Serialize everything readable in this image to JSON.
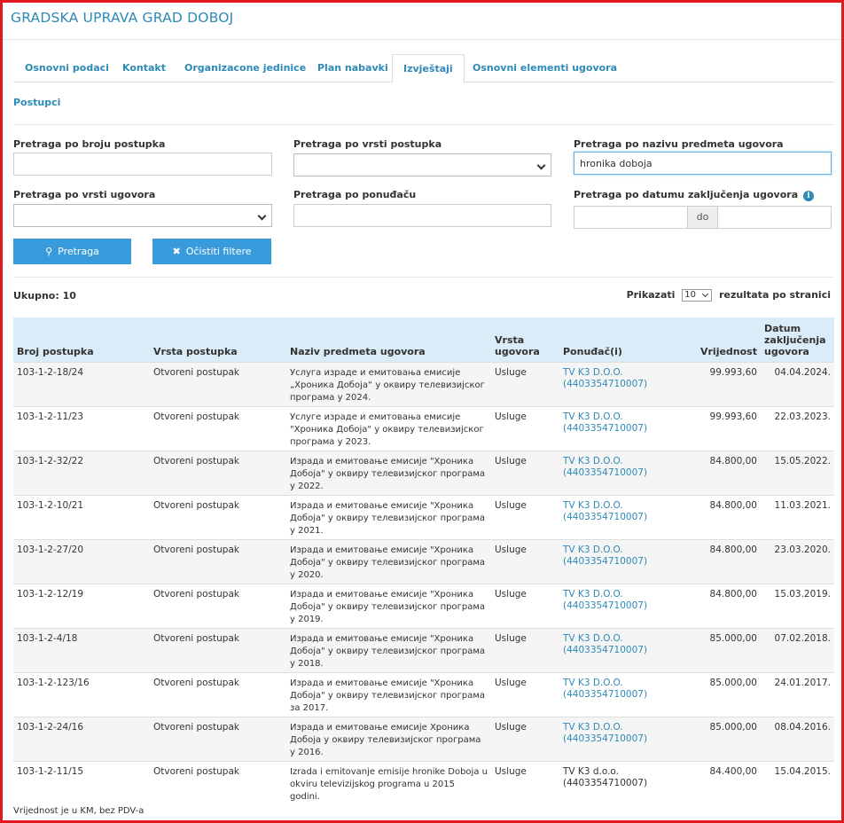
{
  "header": {
    "title": "GRADSKA UPRAVA GRAD DOBOJ"
  },
  "tabs": [
    {
      "label": "Osnovni podaci"
    },
    {
      "label": "Kontakt"
    },
    {
      "label": "Organizacone jedinice"
    },
    {
      "label": "Plan nabavki"
    },
    {
      "label": "Izvještaji",
      "active": true
    },
    {
      "label": "Osnovni elementi ugovora"
    }
  ],
  "subnav": {
    "label": "Postupci"
  },
  "filters": {
    "broj_label": "Pretraga po broju postupka",
    "broj_value": "",
    "vrsta_postupka_label": "Pretraga po vrsti postupka",
    "naziv_label": "Pretraga po nazivu predmeta ugovora",
    "naziv_value": "hronika doboja",
    "vrsta_ugovora_label": "Pretraga po vrsti ugovora",
    "ponudjac_label": "Pretraga po ponuđaču",
    "ponudjac_value": "",
    "datum_label": "Pretraga po datumu zaključenja ugovora",
    "datum_info_icon": "info-icon",
    "date_sep": "do",
    "search_button": "Pretraga",
    "search_icon": "search-icon",
    "clear_button": "Očistiti filtere",
    "clear_icon": "close-icon"
  },
  "results": {
    "total_label": "Ukupno: 10",
    "show_label": "Prikazati",
    "per_page": "10",
    "per_page_suffix": "rezultata po stranici"
  },
  "table": {
    "headers": {
      "broj": "Broj postupka",
      "vrsta": "Vrsta postupka",
      "naziv": "Naziv predmeta ugovora",
      "vrsta_ugovora_1": "Vrsta",
      "vrsta_ugovora_2": "ugovora",
      "ponudjac": "Ponuđač(i)",
      "vrijednost": "Vrijednost",
      "datum_1": "Datum",
      "datum_2": "zaključenja",
      "datum_3": "ugovora"
    },
    "rows": [
      {
        "broj": "103-1-2-18/24",
        "vrsta": "Otvoreni postupak",
        "naziv": "Услуга израде и емитовања емисије „Хроника Добоја“ у оквиру телевизијског програма у 2024.",
        "tip": "Usluge",
        "ponudjac_name": "TV K3 D.O.O.",
        "ponudjac_id": "(4403354710007)",
        "vrijednost": "99.993,60",
        "datum": "04.04.2024."
      },
      {
        "broj": "103-1-2-11/23",
        "vrsta": "Otvoreni postupak",
        "naziv": "Услуге израде и емитовања емисије \"Хроника Добоја\" у оквиру телевизијског програма у 2023.",
        "tip": "Usluge",
        "ponudjac_name": "TV K3 D.O.O.",
        "ponudjac_id": "(4403354710007)",
        "vrijednost": "99.993,60",
        "datum": "22.03.2023."
      },
      {
        "broj": "103-1-2-32/22",
        "vrsta": "Otvoreni postupak",
        "naziv": "Израда и емитовање емисије \"Хроника Добоја\" у оквиру телевизијског програма у 2022.",
        "tip": "Usluge",
        "ponudjac_name": "TV K3 D.O.O.",
        "ponudjac_id": "(4403354710007)",
        "vrijednost": "84.800,00",
        "datum": "15.05.2022."
      },
      {
        "broj": "103-1-2-10/21",
        "vrsta": "Otvoreni postupak",
        "naziv": "Израда и емитовање емисије \"Хроника Добоја\" у оквиру телевизијског програма у 2021.",
        "tip": "Usluge",
        "ponudjac_name": "TV K3 D.O.O.",
        "ponudjac_id": "(4403354710007)",
        "vrijednost": "84.800,00",
        "datum": "11.03.2021."
      },
      {
        "broj": "103-1-2-27/20",
        "vrsta": "Otvoreni postupak",
        "naziv": "Израда и емитовање емисије \"Хроника Добоја\" у оквиру телевизијског програма у 2020.",
        "tip": "Usluge",
        "ponudjac_name": "TV K3 D.O.O.",
        "ponudjac_id": "(4403354710007)",
        "vrijednost": "84.800,00",
        "datum": "23.03.2020."
      },
      {
        "broj": "103-1-2-12/19",
        "vrsta": "Otvoreni postupak",
        "naziv": "Израда и емитовање емисије \"Хроника Добоја\" у оквиру телевизијског програма у 2019.",
        "tip": "Usluge",
        "ponudjac_name": "TV K3 D.O.O.",
        "ponudjac_id": "(4403354710007)",
        "vrijednost": "84.800,00",
        "datum": "15.03.2019."
      },
      {
        "broj": "103-1-2-4/18",
        "vrsta": "Otvoreni postupak",
        "naziv": "Израда и емитовање емисије \"Хроника Добоја\" у оквиру телевизијског програма у 2018.",
        "tip": "Usluge",
        "ponudjac_name": "TV K3 D.O.O.",
        "ponudjac_id": "(4403354710007)",
        "vrijednost": "85.000,00",
        "datum": "07.02.2018."
      },
      {
        "broj": "103-1-2-123/16",
        "vrsta": "Otvoreni postupak",
        "naziv": "Израда и емитовање емисије \"Хроника Добоја\" у оквиру телевизијског програма за 2017.",
        "tip": "Usluge",
        "ponudjac_name": "TV K3 D.O.O.",
        "ponudjac_id": "(4403354710007)",
        "vrijednost": "85.000,00",
        "datum": "24.01.2017."
      },
      {
        "broj": "103-1-2-24/16",
        "vrsta": "Otvoreni postupak",
        "naziv": "Израда и емитовање емисије Хроника Добоја у оквиру телевизијског програма у 2016.",
        "tip": "Usluge",
        "ponudjac_name": "TV K3 D.O.O.",
        "ponudjac_id": "(4403354710007)",
        "vrijednost": "85.000,00",
        "datum": "08.04.2016."
      },
      {
        "broj": "103-1-2-11/15",
        "vrsta": "Otvoreni postupak",
        "naziv": "Izrada i emitovanje emisije hronike Doboja u okviru televizijskog programa u 2015 godini.",
        "tip": "Usluge",
        "ponudjac_name": "TV K3 d.o.o.",
        "ponudjac_id": "(4403354710007)",
        "vrijednost": "84.400,00",
        "datum": "15.04.2015.",
        "plain_ponudjac": true
      }
    ]
  },
  "footer": {
    "note": "Vrijednost je u KM, bez PDV-a"
  },
  "colors": {
    "accent": "#2d89b6",
    "button": "#3a9bdc",
    "table_header": "#d9ecf7",
    "frame": "#e0191e"
  }
}
